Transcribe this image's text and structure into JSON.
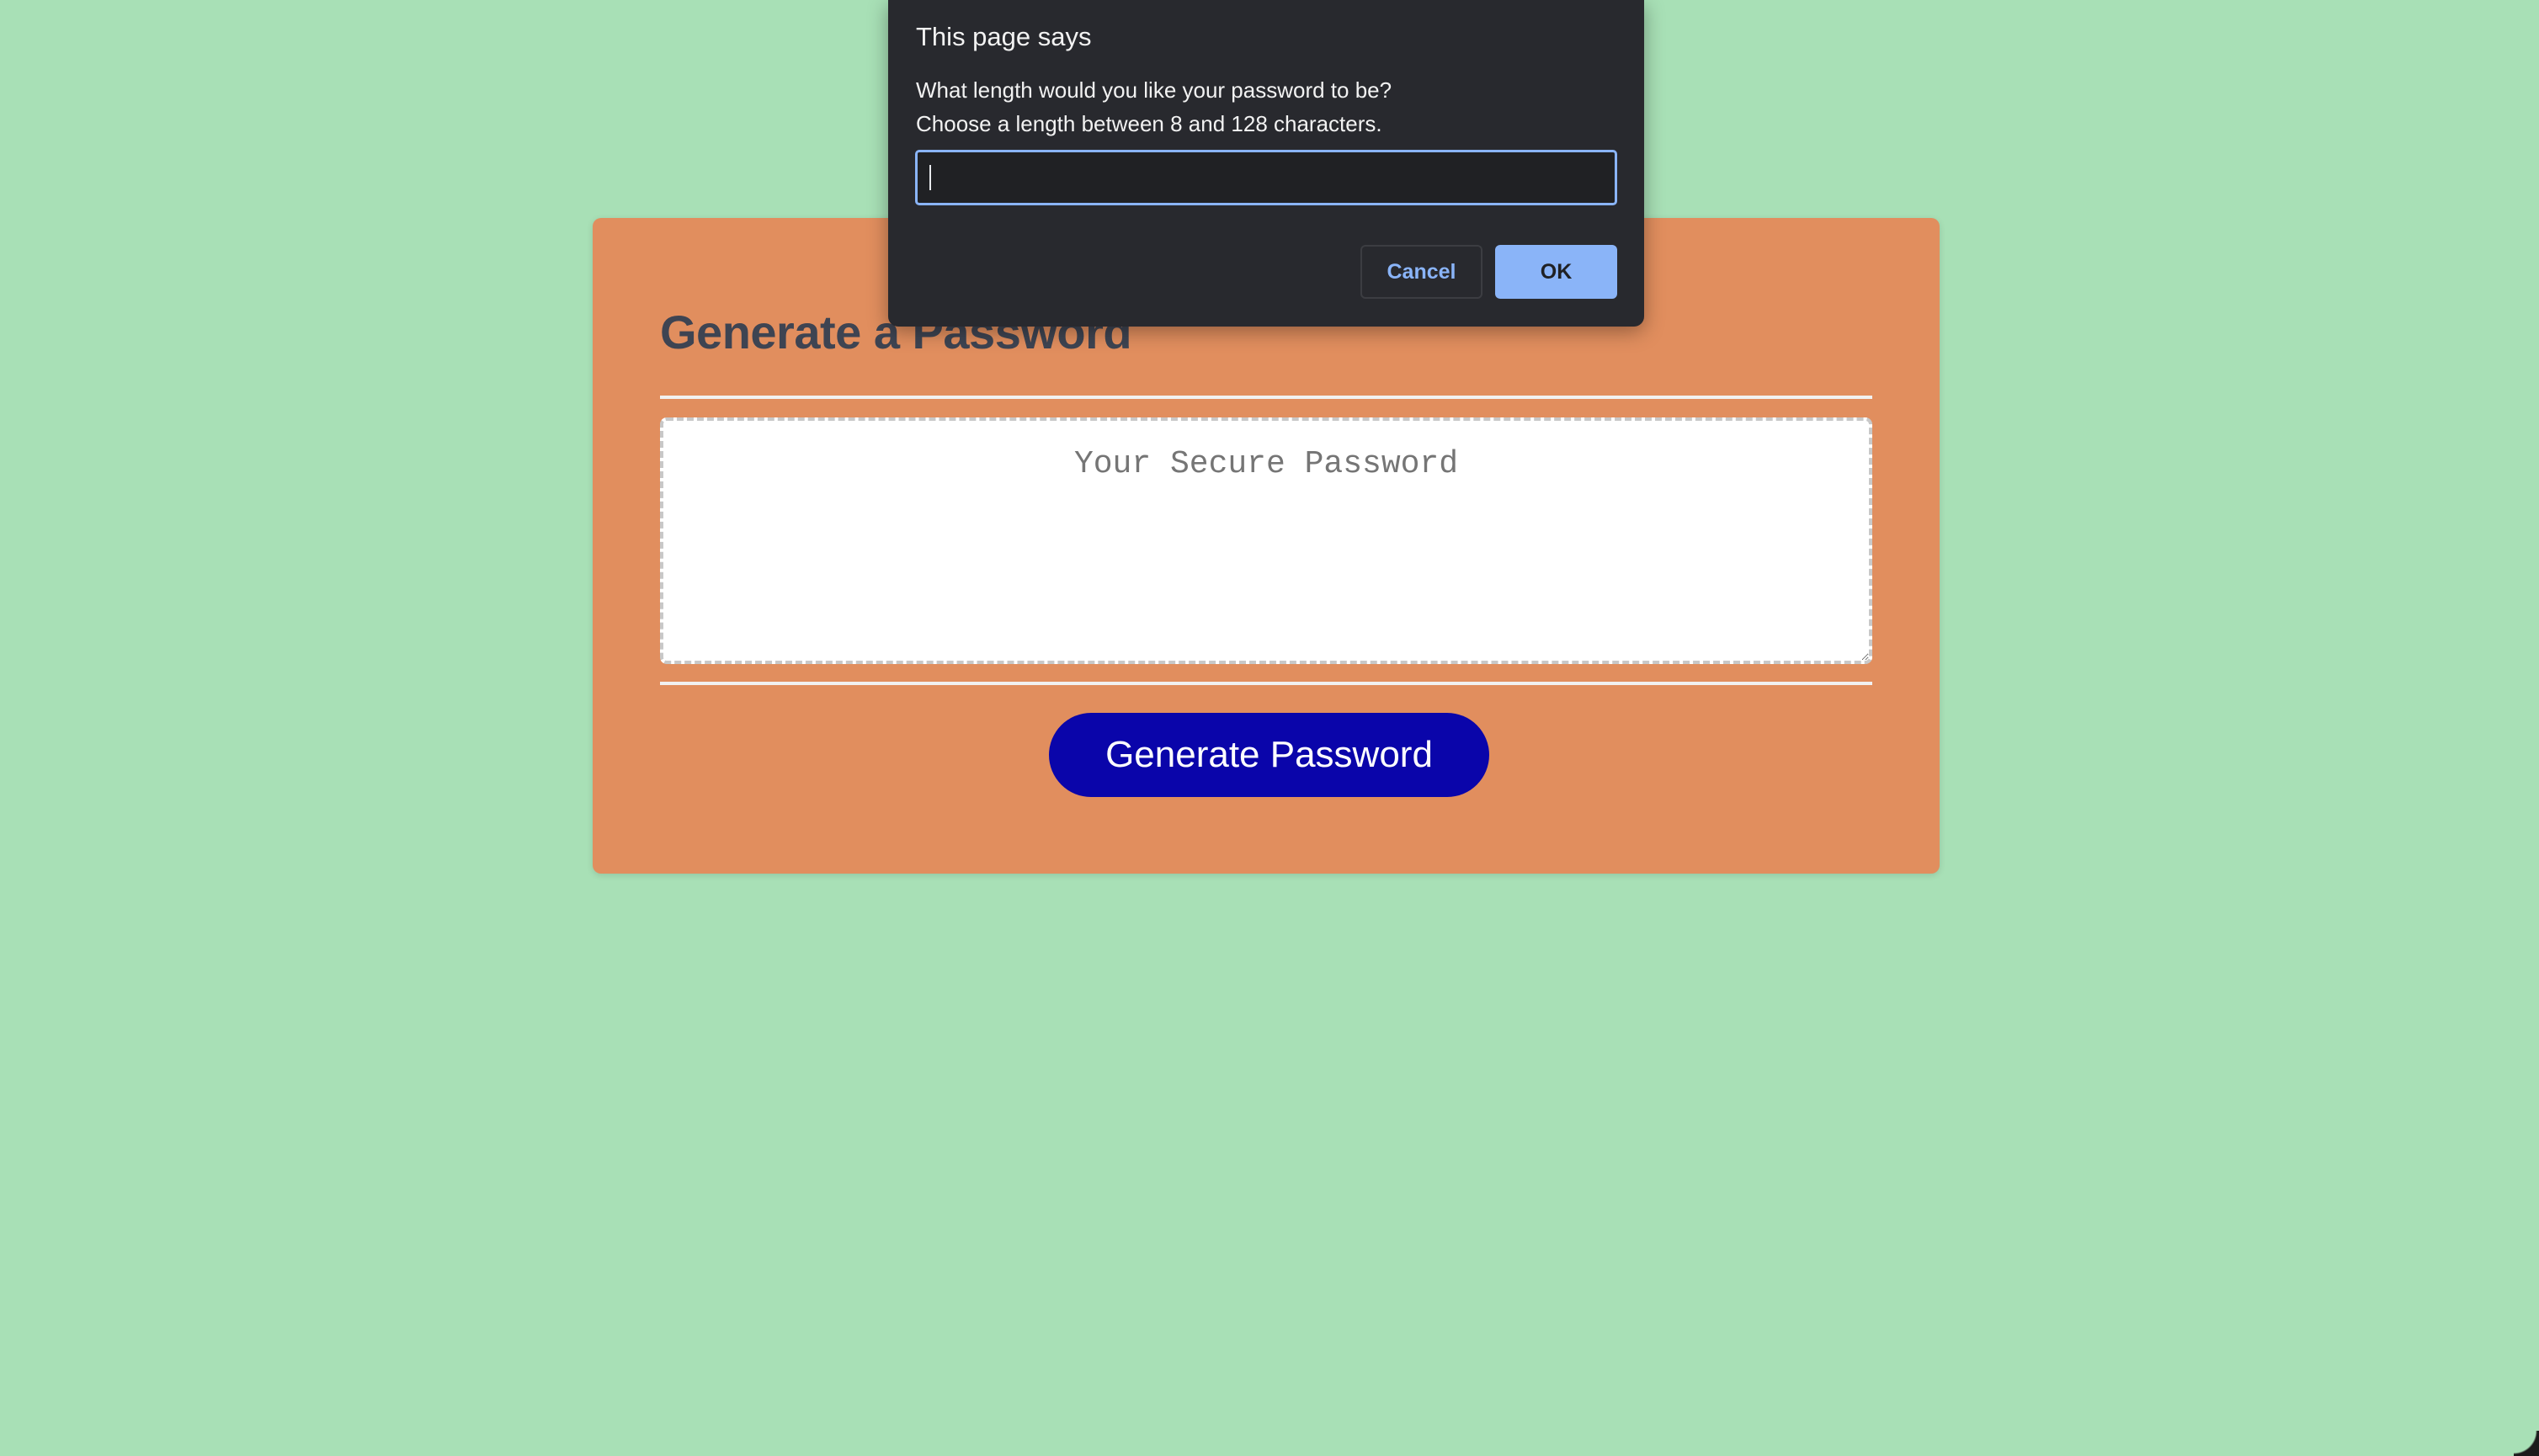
{
  "page": {
    "background_color": "#a8e0b6"
  },
  "card": {
    "title": "Generate a Password",
    "background_color": "#e18e5e",
    "password_placeholder": "Your Secure Password",
    "password_value": "",
    "generate_button_label": "Generate Password",
    "generate_button_color": "#0a05aa"
  },
  "dialog": {
    "title": "This page says",
    "message_lines": [
      "What length would you like your password to be?",
      "Choose a length between 8 and 128 characters."
    ],
    "input_value": "",
    "cancel_label": "Cancel",
    "ok_label": "OK",
    "accent_color": "#8ab4f8",
    "background_color": "#28292e"
  }
}
